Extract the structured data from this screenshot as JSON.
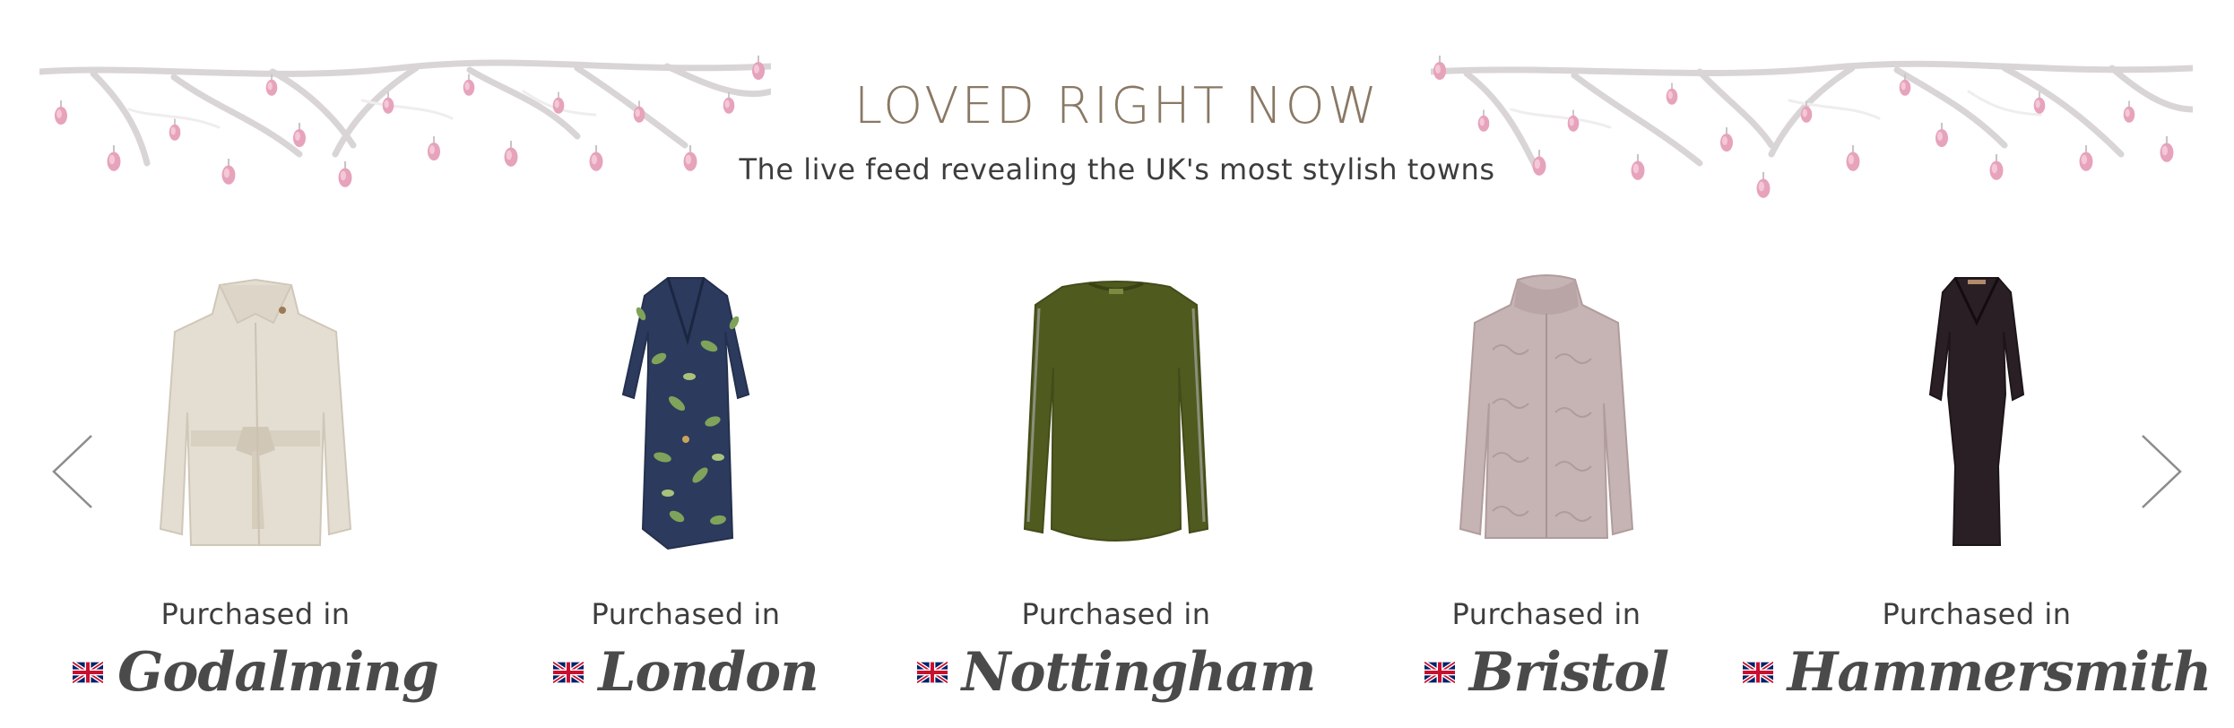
{
  "banner": {
    "title": "LOVED RIGHT NOW",
    "subtitle": "The live feed revealing the UK's most stylish towns",
    "decoration": "blossom-branch-illustration"
  },
  "carousel": {
    "prev_icon": "chevron-left-icon",
    "next_icon": "chevron-right-icon",
    "items": [
      {
        "purchased_label": "Purchased in",
        "town": "Godalming",
        "flag": "uk-flag-icon",
        "product": "cream-wrap-coat"
      },
      {
        "purchased_label": "Purchased in",
        "town": "London",
        "flag": "uk-flag-icon",
        "product": "navy-floral-wrap-dress"
      },
      {
        "purchased_label": "Purchased in",
        "town": "Nottingham",
        "flag": "uk-flag-icon",
        "product": "olive-green-jumper"
      },
      {
        "purchased_label": "Purchased in",
        "town": "Bristol",
        "flag": "uk-flag-icon",
        "product": "pink-faux-fur-jacket"
      },
      {
        "purchased_label": "Purchased in",
        "town": "Hammersmith",
        "flag": "uk-flag-icon",
        "product": "black-bodycon-dress"
      }
    ]
  },
  "colors": {
    "heading": "#8a7864",
    "text": "#3d3d3d",
    "arrow": "#8c8c8c",
    "blossom": "#e8a6bd"
  }
}
